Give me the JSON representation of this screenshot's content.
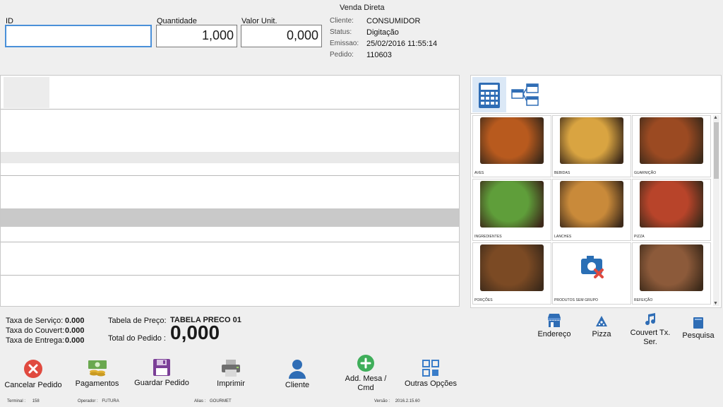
{
  "header": {
    "title": "Venda Direta",
    "id_label": "ID",
    "id_value": "",
    "qty_label": "Quantidade",
    "qty_value": "1,000",
    "price_label": "Valor Unit.",
    "price_value": "0,000",
    "info": {
      "cliente_label": "Cliente:",
      "cliente_value": "CONSUMIDOR",
      "status_label": "Status:",
      "status_value": "Digitação",
      "emissao_label": "Emissao:",
      "emissao_value": "25/02/2016 11:55:14",
      "pedido_label": "Pedido:",
      "pedido_value": "110603"
    }
  },
  "categories": [
    {
      "label": "AVES",
      "icon": "roast-chicken-photo",
      "color": "#b85a1e"
    },
    {
      "label": "BEBIDAS",
      "icon": "drinks-photo",
      "color": "#d9a441"
    },
    {
      "label": "GUARNIÇÃO",
      "icon": "side-dishes-photo",
      "color": "#9b4a22"
    },
    {
      "label": "INGREDIENTES",
      "icon": "vegetables-photo",
      "color": "#5f9e3a"
    },
    {
      "label": "LANCHES",
      "icon": "burger-photo",
      "color": "#c98a3a"
    },
    {
      "label": "PIZZA",
      "icon": "pizza-photo",
      "color": "#b8442a"
    },
    {
      "label": "PORÇÕES",
      "icon": "portions-photo",
      "color": "#7b4a24"
    },
    {
      "label": "PRODUTOS SEM GRUPO",
      "icon": "no-image-icon",
      "color": "#2a6fb5"
    },
    {
      "label": "REFEIÇÃO",
      "icon": "meal-photo",
      "color": "#8c5a3a"
    }
  ],
  "totals": {
    "servico_label": "Taxa de Serviço:",
    "servico_value": "0.000",
    "couvert_label": "Taxa do Couvert:",
    "couvert_value": "0.000",
    "entrega_label": "Taxa de Entrega:",
    "entrega_value": "0.000",
    "tabela_label": "Tabela de Preço:",
    "tabela_value": "TABELA PRECO 01",
    "total_label": "Total do Pedido :",
    "total_value": "0,000"
  },
  "right_actions": {
    "endereco": "Endereço",
    "pizza": "Pizza",
    "couvert": "Couvert Tx. Ser.",
    "pesquisa": "Pesquisa"
  },
  "actions": {
    "cancelar": "Cancelar Pedido",
    "pagamentos": "Pagamentos",
    "guardar": "Guardar Pedido",
    "imprimir": "Imprimir",
    "cliente": "Cliente",
    "add_mesa": "Add. Mesa / Cmd",
    "outras": "Outras Opções"
  },
  "footer": {
    "terminal_label": "Terminal :",
    "terminal_value": "158",
    "operador_label": "Operador :",
    "operador_value": "FUTURA",
    "alias_label": "Alias :",
    "alias_value": "GOURMET",
    "versao_label": "Versão :",
    "versao_value": "2016.2.15.60"
  },
  "colors": {
    "cancel": "#e04a3f",
    "guardar": "#7b3f97",
    "cliente": "#2f6db5",
    "add": "#3fae5a",
    "outras": "#3a7dc9",
    "pagamentos": "#6aa84f"
  }
}
